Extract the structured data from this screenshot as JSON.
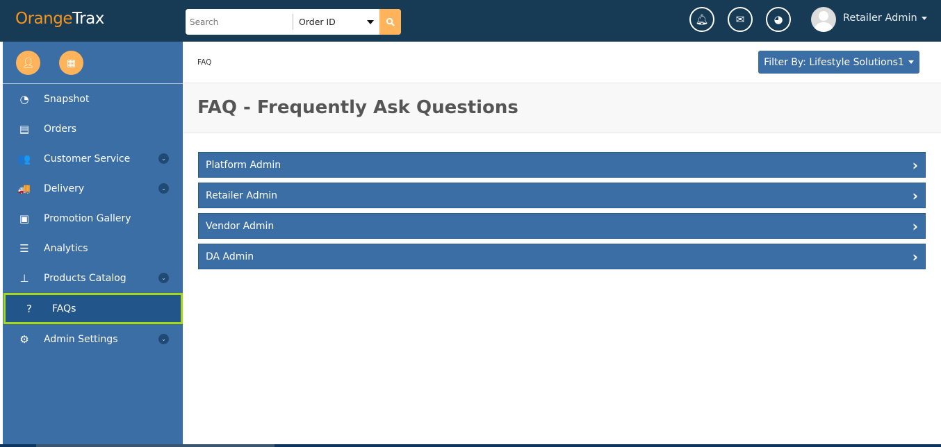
{
  "header": {
    "logo_prefix": "O",
    "logo_orange": "range",
    "logo_white": "Trax",
    "search_placeholder": "Search",
    "search_type": "Order ID",
    "user_name": "Retailer Admin"
  },
  "sidebar": {
    "items": [
      {
        "label": "Snapshot",
        "icon": "dashboard-icon",
        "glyph": "◔",
        "has_submenu": false
      },
      {
        "label": "Orders",
        "icon": "file-icon",
        "glyph": "▤",
        "has_submenu": false
      },
      {
        "label": "Customer Service",
        "icon": "users-icon",
        "glyph": "👥",
        "has_submenu": true
      },
      {
        "label": "Delivery",
        "icon": "truck-icon",
        "glyph": "🚚",
        "has_submenu": true
      },
      {
        "label": "Promotion Gallery",
        "icon": "image-icon",
        "glyph": "▣",
        "has_submenu": false
      },
      {
        "label": "Analytics",
        "icon": "list-icon",
        "glyph": "☰",
        "has_submenu": false
      },
      {
        "label": "Products Catalog",
        "icon": "sitemap-icon",
        "glyph": "⊥",
        "has_submenu": true
      },
      {
        "label": "FAQs",
        "icon": "question-circle-icon",
        "glyph": "?",
        "active": true
      },
      {
        "label": "Admin Settings",
        "icon": "gears-icon",
        "glyph": "⚙",
        "has_submenu": true
      }
    ]
  },
  "main": {
    "breadcrumb": "FAQ",
    "filter_label": "Filter By: Lifestyle Solutions1",
    "title": "FAQ - Frequently Ask Questions",
    "sections": [
      "Platform Admin",
      "Retailer Admin",
      "Vendor Admin",
      "DA Admin"
    ]
  },
  "colors": {
    "topbar": "#173a55",
    "primary": "#3a6ea5",
    "accent": "#ffb45c",
    "highlight": "#a6d81a"
  }
}
